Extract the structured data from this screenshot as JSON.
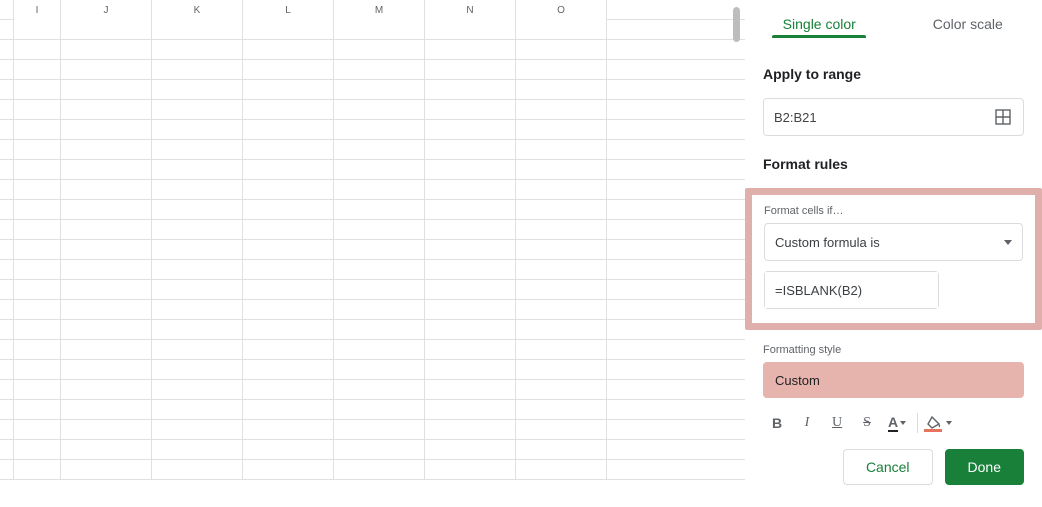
{
  "grid": {
    "columns": [
      "I",
      "J",
      "K",
      "L",
      "M",
      "N",
      "O"
    ],
    "rowcount": 23
  },
  "panel": {
    "tabs": {
      "single": "Single color",
      "scale": "Color scale"
    },
    "apply_to_range_label": "Apply to range",
    "range_value": "B2:B21",
    "format_rules_label": "Format rules",
    "format_cells_if_label": "Format cells if…",
    "condition_selected": "Custom formula is",
    "formula_value": "=ISBLANK(B2)",
    "formatting_style_label": "Formatting style",
    "style_name": "Custom",
    "toolbar": {
      "bold": "B",
      "italic": "I",
      "underline": "U",
      "strike": "S",
      "textcolor_glyph": "A"
    },
    "buttons": {
      "cancel": "Cancel",
      "done": "Done"
    }
  }
}
